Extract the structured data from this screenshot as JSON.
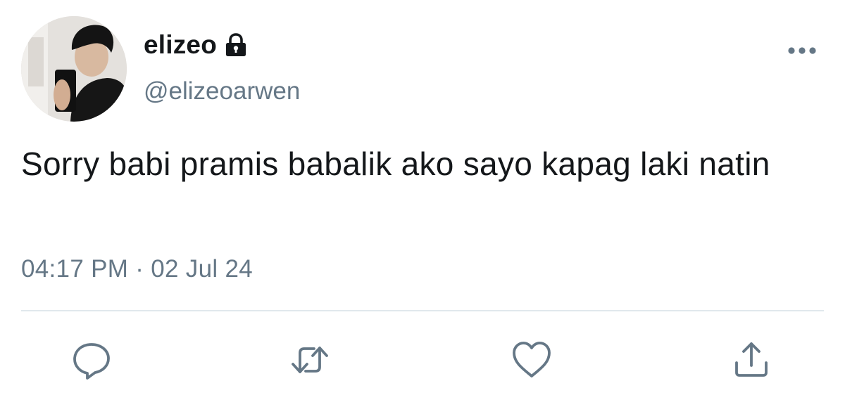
{
  "tweet": {
    "display_name": "elizeo",
    "protected_icon": "lock-icon",
    "handle": "@elizeoarwen",
    "text": "Sorry babi pramis babalik ako sayo kapag laki natin",
    "time": "04:17 PM",
    "separator": "·",
    "date": "02 Jul 24",
    "more_icon": "more-horizontal-icon",
    "actions": [
      {
        "name": "reply",
        "icon": "reply-icon"
      },
      {
        "name": "retweet",
        "icon": "retweet-icon"
      },
      {
        "name": "like",
        "icon": "heart-icon"
      },
      {
        "name": "share",
        "icon": "share-icon"
      }
    ],
    "colors": {
      "text": "#14171a",
      "secondary": "#657786",
      "divider": "#e1e8ed"
    }
  }
}
